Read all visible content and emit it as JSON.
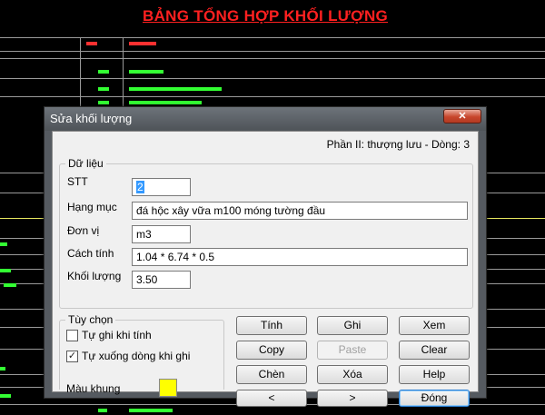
{
  "background": {
    "drawing_title": "BẢNG TỔNG HỢP KHỐI LƯỢNG",
    "colors": {
      "title": "#ff2020",
      "text": "#33ff33",
      "lines": "#9a9a9a"
    }
  },
  "dialog": {
    "title": "Sửa khối lượng",
    "subtitle": "Phần II: thượng lưu - Dòng: 3",
    "close_icon": "close-icon",
    "data_group": {
      "legend": "Dữ liệu",
      "stt_label": "STT",
      "stt_value": "2",
      "hang_muc_label": "Hạng mục",
      "hang_muc_value": "đá hộc xây vữa m100 móng tường đầu",
      "don_vi_label": "Đơn vị",
      "don_vi_value": "m3",
      "cach_tinh_label": "Cách tính",
      "cach_tinh_value": "1.04 * 6.74 * 0.5",
      "khoi_luong_label": "Khối lượng",
      "khoi_luong_value": "3.50"
    },
    "options_group": {
      "legend": "Tùy chọn",
      "auto_save_label": "Tự ghi khi tính",
      "auto_save_checked": false,
      "auto_down_label": "Tự xuống dòng khi ghi",
      "auto_down_checked": true,
      "frame_color_label": "Màu khung",
      "frame_color": "#ffff00"
    },
    "buttons": {
      "tinh": "Tính",
      "ghi": "Ghi",
      "xem": "Xem",
      "copy": "Copy",
      "paste": "Paste",
      "clear": "Clear",
      "chen": "Chèn",
      "xoa": "Xóa",
      "help": "Help",
      "prev": "<",
      "next": ">",
      "dong": "Đóng"
    }
  }
}
